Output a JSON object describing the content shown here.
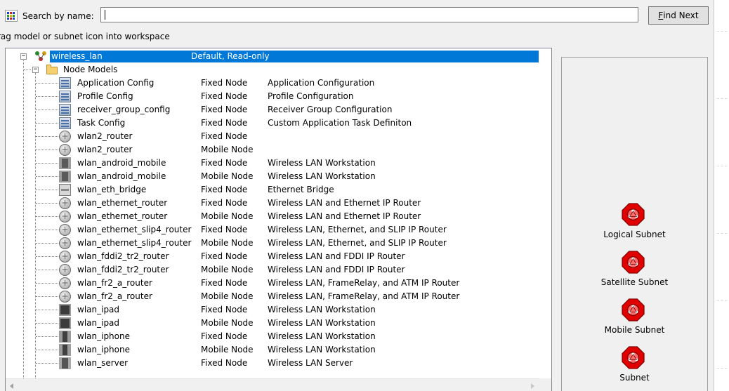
{
  "search": {
    "label": "Search by name:",
    "value": "",
    "find_next_mnemonic": "F",
    "find_next_rest": "ind Next"
  },
  "hint": "rag model or subnet icon into workspace",
  "tree": {
    "root": {
      "name": "wireless_lan",
      "type": "Default, Read-only",
      "desc": ""
    },
    "folder": {
      "name": "Node Models"
    },
    "rows": [
      {
        "name": "Application Config",
        "type": "Fixed Node",
        "desc": "Application Configuration",
        "icon": "config-icon"
      },
      {
        "name": "Profile Config",
        "type": "Fixed Node",
        "desc": "Profile Configuration",
        "icon": "config-icon"
      },
      {
        "name": "receiver_group_config",
        "type": "Fixed Node",
        "desc": "Receiver Group Configuration",
        "icon": "config-icon"
      },
      {
        "name": "Task Config",
        "type": "Fixed Node",
        "desc": "Custom Application Task Definiton",
        "icon": "config-icon"
      },
      {
        "name": "wlan2_router",
        "type": "Fixed Node",
        "desc": "",
        "icon": "router-icon"
      },
      {
        "name": "wlan2_router",
        "type": "Mobile Node",
        "desc": "",
        "icon": "router-icon"
      },
      {
        "name": "wlan_android_mobile",
        "type": "Fixed Node",
        "desc": "Wireless LAN Workstation",
        "icon": "mobile-icon"
      },
      {
        "name": "wlan_android_mobile",
        "type": "Mobile Node",
        "desc": "Wireless LAN Workstation",
        "icon": "mobile-icon"
      },
      {
        "name": "wlan_eth_bridge",
        "type": "Fixed Node",
        "desc": "Ethernet Bridge",
        "icon": "bridge-icon"
      },
      {
        "name": "wlan_ethernet_router",
        "type": "Fixed Node",
        "desc": "Wireless LAN and Ethernet IP Router",
        "icon": "router-icon"
      },
      {
        "name": "wlan_ethernet_router",
        "type": "Mobile Node",
        "desc": "Wireless LAN and Ethernet IP Router",
        "icon": "router-icon"
      },
      {
        "name": "wlan_ethernet_slip4_router",
        "type": "Fixed Node",
        "desc": "Wireless LAN, Ethernet, and SLIP IP Router",
        "icon": "router-icon"
      },
      {
        "name": "wlan_ethernet_slip4_router",
        "type": "Mobile Node",
        "desc": "Wireless LAN, Ethernet, and SLIP IP Router",
        "icon": "router-icon"
      },
      {
        "name": "wlan_fddi2_tr2_router",
        "type": "Fixed Node",
        "desc": "Wireless LAN and FDDI IP Router",
        "icon": "router-icon"
      },
      {
        "name": "wlan_fddi2_tr2_router",
        "type": "Mobile Node",
        "desc": "Wireless LAN and FDDI IP Router",
        "icon": "router-icon"
      },
      {
        "name": "wlan_fr2_a_router",
        "type": "Fixed Node",
        "desc": "Wireless LAN, FrameRelay, and ATM IP Router",
        "icon": "router-icon"
      },
      {
        "name": "wlan_fr2_a_router",
        "type": "Mobile Node",
        "desc": "Wireless LAN, FrameRelay, and ATM IP Router",
        "icon": "router-icon"
      },
      {
        "name": "wlan_ipad",
        "type": "Fixed Node",
        "desc": "Wireless LAN Workstation",
        "icon": "ipad-icon"
      },
      {
        "name": "wlan_ipad",
        "type": "Mobile Node",
        "desc": "Wireless LAN Workstation",
        "icon": "ipad-icon"
      },
      {
        "name": "wlan_iphone",
        "type": "Fixed Node",
        "desc": "Wireless LAN Workstation",
        "icon": "phone-icon"
      },
      {
        "name": "wlan_iphone",
        "type": "Mobile Node",
        "desc": "Wireless LAN Workstation",
        "icon": "phone-icon"
      },
      {
        "name": "wlan_server",
        "type": "Fixed Node",
        "desc": "Wireless LAN Server",
        "icon": "server-icon"
      }
    ]
  },
  "subnets": [
    {
      "label": "Logical Subnet",
      "icon": "logical-subnet-icon"
    },
    {
      "label": "Satellite Subnet",
      "icon": "satellite-subnet-icon"
    },
    {
      "label": "Mobile Subnet",
      "icon": "mobile-subnet-icon"
    },
    {
      "label": "Subnet",
      "icon": "subnet-icon"
    }
  ],
  "colors": {
    "selection": "#0078d7",
    "subnet_red": "#e00000"
  }
}
